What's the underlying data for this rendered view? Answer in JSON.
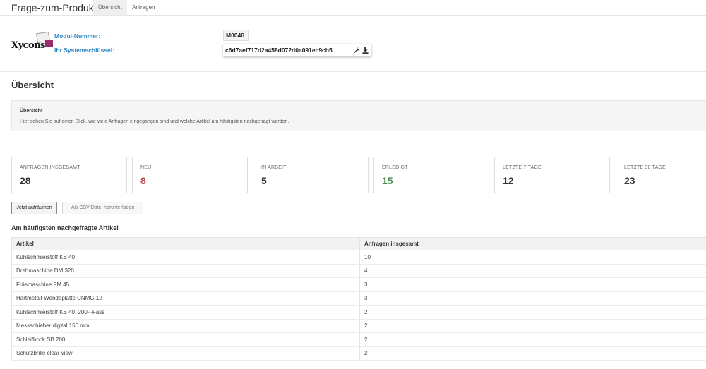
{
  "app": {
    "title": "Frage-zum-Produkt"
  },
  "tabs": [
    {
      "label": "Übersicht",
      "active": true
    },
    {
      "label": "Anfragen",
      "active": false
    }
  ],
  "module": {
    "logo_text": "Xycons",
    "number_label": "Modul-Nummer:",
    "number_value": "M0046",
    "key_label": "Ihr Systemschlüssel:",
    "key_value": "c6d7aef717d2a458d072d0a091ec9cb5",
    "key_icons": [
      "wrench-icon",
      "download-icon"
    ]
  },
  "overview": {
    "title": "Übersicht",
    "info_title": "Übersicht",
    "info_text": "Hier sehen Sie auf einen Blick, wie viele Anfragen eingegangen sind und welche Artikel am häufigsten nachgefragt werden."
  },
  "stats": [
    {
      "label": "ANFRAGEN INSGESAMT",
      "value": "28",
      "color": "#333333"
    },
    {
      "label": "NEU",
      "value": "8",
      "color": "#b94a48"
    },
    {
      "label": "IN ARBEIT",
      "value": "5",
      "color": "#333333"
    },
    {
      "label": "ERLEDIGT",
      "value": "15",
      "color": "#468847"
    },
    {
      "label": "LETZTE 7 TAGE",
      "value": "12",
      "color": "#333333"
    },
    {
      "label": "LETZTE 30 TAGE",
      "value": "23",
      "color": "#333333"
    }
  ],
  "buttons": {
    "clean": "Jetzt aufräumen",
    "csv": "Als CSV-Datei herunterladen"
  },
  "top_articles": {
    "title": "Am häufigsten nachgefragte Artikel",
    "columns": [
      "Artikel",
      "Anfragen insgesamt"
    ],
    "rows": [
      [
        "Kühlschmierstoff KS 40",
        "10"
      ],
      [
        "Drehmaschine DM 320",
        "4"
      ],
      [
        "Fräsmaschine FM 45",
        "3"
      ],
      [
        "Hartmetall-Wendeplatte CNMG 12",
        "3"
      ],
      [
        "Kühlschmierstoff KS 40, 200-l-Fass",
        "2"
      ],
      [
        "Messschieber digital 150 mm",
        "2"
      ],
      [
        "Schleifbock SB 200",
        "2"
      ],
      [
        "Schutzbrille clear-view",
        "2"
      ]
    ]
  }
}
